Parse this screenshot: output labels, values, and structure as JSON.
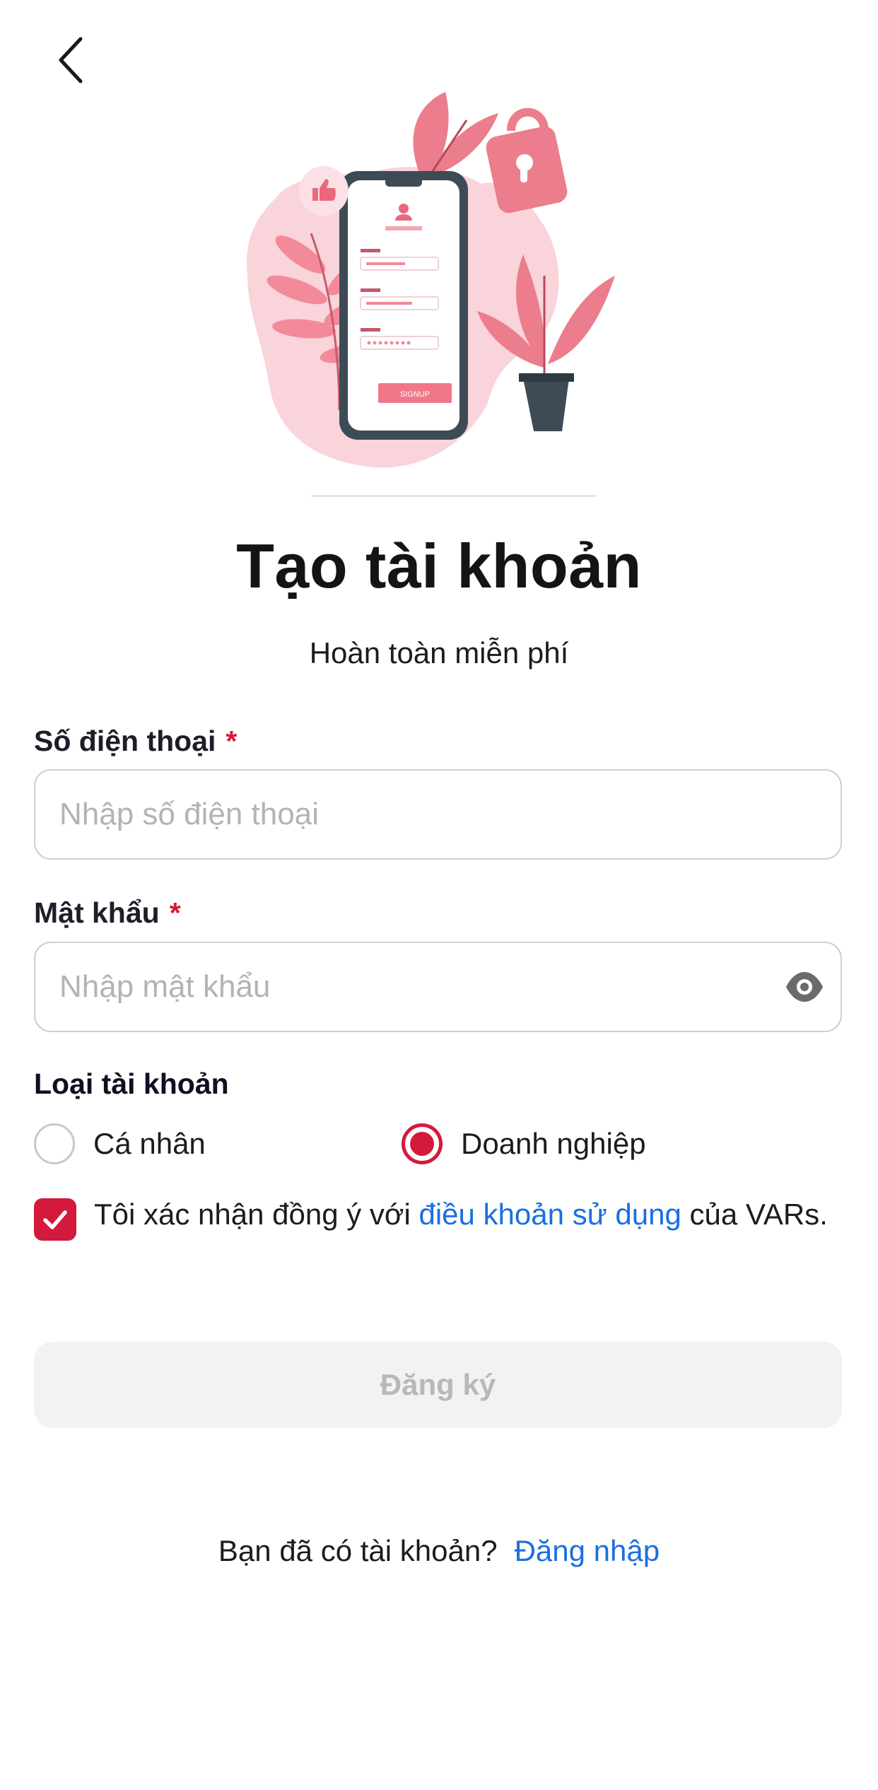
{
  "header": {
    "back_icon": "chevron-left-icon"
  },
  "hero": {
    "signup_button_text": "SIGNUP"
  },
  "title": "Tạo tài khoản",
  "subtitle": "Hoàn toàn miễn phí",
  "form": {
    "phone": {
      "label": "Số điện thoại",
      "required_mark": "*",
      "placeholder": "Nhập số điện thoại",
      "value": ""
    },
    "password": {
      "label": "Mật khẩu",
      "required_mark": "*",
      "placeholder": "Nhập mật khẩu",
      "value": "",
      "toggle_icon": "eye-icon"
    },
    "account_type": {
      "label": "Loại tài khoản",
      "options": [
        {
          "label": "Cá nhân",
          "selected": false
        },
        {
          "label": "Doanh nghiệp",
          "selected": true
        }
      ]
    },
    "terms": {
      "checked": true,
      "prefix": "Tôi xác nhận đồng ý với ",
      "link": "điều khoản sử dụng",
      "suffix": " của VARs."
    },
    "submit_label": "Đăng ký"
  },
  "footer": {
    "prompt": "Bạn đã có tài khoản?",
    "login_link": "Đăng nhập"
  },
  "colors": {
    "accent": "#d31a3c",
    "link": "#1a6fe0",
    "disabled_bg": "#f2f2f2",
    "disabled_text": "#b8b8b8"
  }
}
